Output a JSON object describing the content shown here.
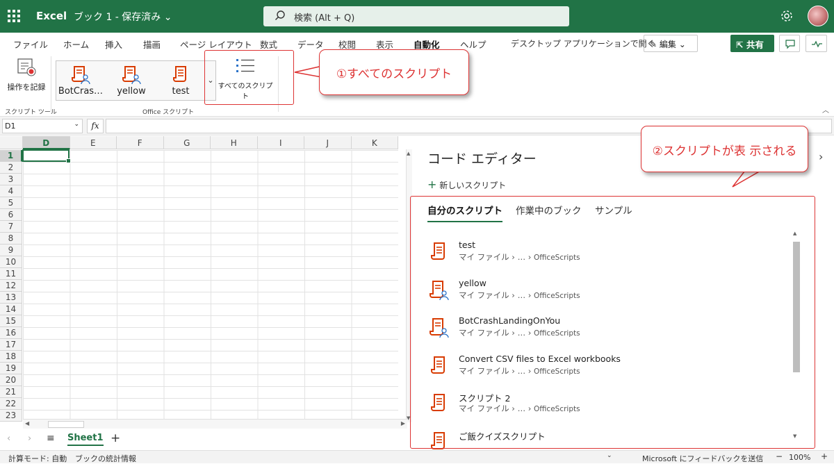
{
  "app": {
    "name": "Excel",
    "doc_title": "ブック 1 - 保存済み"
  },
  "search": {
    "text": "検索 (Alt + Q)"
  },
  "menu": {
    "tabs": [
      "ファイル",
      "ホーム",
      "挿入",
      "描画",
      "ページ レイアウト",
      "数式",
      "データ",
      "校閲",
      "表示",
      "自動化",
      "ヘルプ"
    ],
    "active": "自動化",
    "open_desktop": "デスクトップ アプリケーションで開く",
    "edit_label": "編集",
    "share_label": "共有"
  },
  "ribbon": {
    "record_label": "操作を記録",
    "group1_label": "スクリプト ツール",
    "gallery_items": [
      "BotCras…",
      "yellow",
      "test"
    ],
    "all_scripts_label": "すべてのスクリプト",
    "group2_label": "Office スクリプト"
  },
  "callouts": {
    "c1": "①すべてのスクリプト",
    "c2": "②スクリプトが表 示される"
  },
  "formula": {
    "namebox": "D1",
    "fx": "fx"
  },
  "grid": {
    "columns": [
      "D",
      "E",
      "F",
      "G",
      "H",
      "I",
      "J",
      "K"
    ],
    "rows": [
      "1",
      "2",
      "3",
      "4",
      "5",
      "6",
      "7",
      "8",
      "9",
      "10",
      "11",
      "12",
      "13",
      "14",
      "15",
      "16",
      "17",
      "18",
      "19",
      "20",
      "21",
      "22",
      "23"
    ],
    "active_cell": "D1"
  },
  "sheets": {
    "names": [
      "Sheet1"
    ]
  },
  "status": {
    "calc_mode": "計算モード: 自動",
    "stats": "ブックの統計情報",
    "feedback": "Microsoft にフィードバックを送信",
    "zoom": "100%"
  },
  "editor": {
    "title": "コード エディター",
    "new_script": "新しいスクリプト",
    "tabs": [
      "自分のスクリプト",
      "作業中のブック",
      "サンプル"
    ],
    "path_prefix": "マイ ファイル",
    "path_mid": "…",
    "path_end": "OfficeScripts",
    "scripts": [
      {
        "name": "test",
        "shared": false
      },
      {
        "name": "yellow",
        "shared": true
      },
      {
        "name": "BotCrashLandingOnYou",
        "shared": true
      },
      {
        "name": "Convert CSV files to Excel workbooks",
        "shared": false
      },
      {
        "name": "スクリプト 2",
        "shared": false
      },
      {
        "name": "ご飯クイズスクリプト",
        "shared": false
      }
    ]
  },
  "colors": {
    "brand": "#217346",
    "callout": "#dd3333",
    "script_icon": "#d83b01"
  }
}
